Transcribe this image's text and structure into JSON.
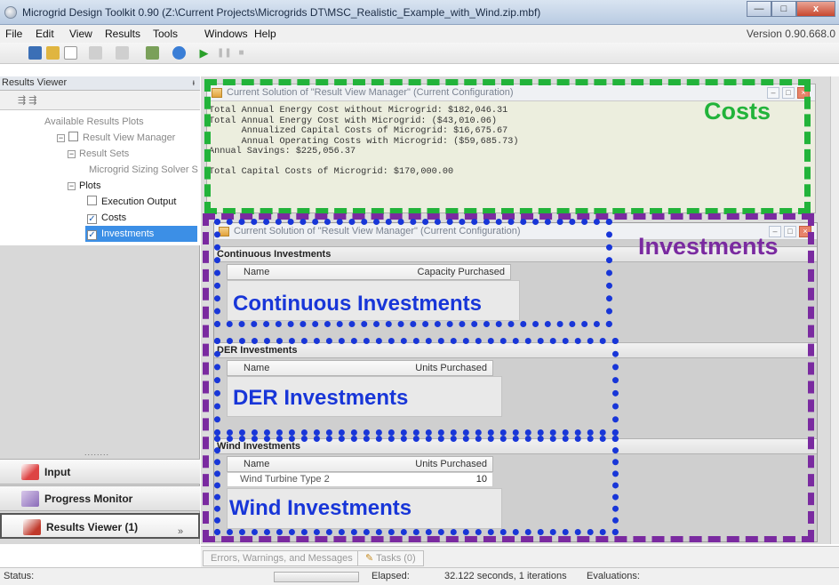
{
  "window": {
    "title": "Microgrid Design Toolkit 0.90 (Z:\\Current Projects\\Microgrids DT\\MSC_Realistic_Example_with_Wind.zip.mbf)",
    "minimize": "—",
    "maximize": "□",
    "close": "x"
  },
  "menu": {
    "items": [
      "File",
      "Edit",
      "View",
      "Results",
      "Tools",
      "Windows",
      "Help"
    ],
    "version": "Version 0.90.668.0"
  },
  "results_viewer": {
    "header": "Results Viewer",
    "pin": "ᵼ",
    "tools": "⇶ ⇶",
    "tree": {
      "root": "Available Results Plots",
      "manager": "Result View Manager",
      "result_sets": "Result Sets",
      "solver": "Microgrid Sizing Solver S",
      "plots": "Plots",
      "plot_items": [
        {
          "label": "Execution Output",
          "checked": false
        },
        {
          "label": "Costs",
          "checked": true
        },
        {
          "label": "Investments",
          "checked": true
        }
      ]
    },
    "drag_handle": "........",
    "nav": [
      "Input",
      "Progress Monitor",
      "Results Viewer (1)"
    ],
    "chevron": "»"
  },
  "costs_window": {
    "title": "Current Solution of \"Result View Manager\" (Current Configuration)",
    "lines": [
      "Total Annual Energy Cost without Microgrid: $182,046.31",
      "Total Annual Energy Cost with Microgrid: ($43,010.06)",
      "      Annualized Capital Costs of Microgrid: $16,675.67",
      "      Annual Operating Costs with Microgrid: ($59,685.73)",
      "Annual Savings: $225,056.37",
      "",
      "Total Capital Costs of Microgrid: $170,000.00"
    ]
  },
  "investments_window": {
    "title": "Current Solution of \"Result View Manager\" (Current Configuration)",
    "continuous": {
      "header": "Continuous Investments",
      "col_name": "Name",
      "col_value": "Capacity Purchased"
    },
    "der": {
      "header": "DER Investments",
      "col_name": "Name",
      "col_value": "Units Purchased"
    },
    "wind": {
      "header": "Wind Investments",
      "col_name": "Name",
      "col_value": "Units Purchased",
      "rows": [
        {
          "name": "Wind Turbine Type 2",
          "value": "10"
        }
      ]
    }
  },
  "annotations": {
    "costs": "Costs",
    "investments": "Investments",
    "continuous": "Continuous Investments",
    "der": "DER Investments",
    "wind": "Wind Investments",
    "colors": {
      "costs": "#22b33a",
      "investments": "#7a2aa0",
      "sections": "#1836d8"
    }
  },
  "bottom_tabs": [
    "Errors, Warnings, and Messages",
    "Tasks (0)"
  ],
  "status": {
    "label": "Status:",
    "elapsed_label": "Elapsed:",
    "elapsed_value": "32.122 seconds, 1 iterations",
    "evaluations_label": "Evaluations:"
  }
}
